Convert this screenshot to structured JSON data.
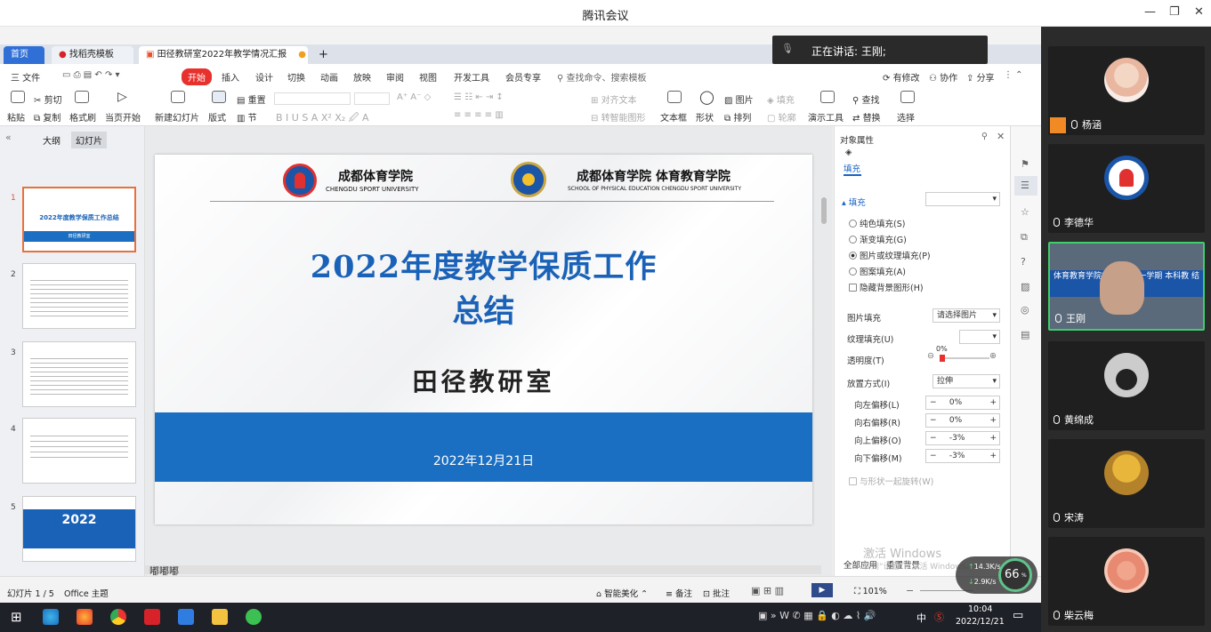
{
  "meeting": {
    "title": "腾讯会议",
    "speaking_label": "正在讲话: 王刚;"
  },
  "tabs": [
    {
      "label": "首页"
    },
    {
      "label": "找稻壳模板"
    },
    {
      "label": "田径教研室2022年教学情况汇报"
    }
  ],
  "menu": {
    "file": "三 文件",
    "start": "开始",
    "items": [
      "插入",
      "设计",
      "切换",
      "动画",
      "放映",
      "审阅",
      "视图",
      "开发工具",
      "会员专享"
    ],
    "search_placeholder": "查找命令、搜索模板",
    "right": [
      "有修改",
      "协作",
      "分享"
    ]
  },
  "ribbon": {
    "paste": "粘贴",
    "cut": "剪切",
    "copy": "复制",
    "format_painter": "格式刷",
    "from_current": "当页开始",
    "new_slide": "新建幻灯片",
    "layout": "版式",
    "section": "节",
    "reset": "重置",
    "align_text": "对齐文本",
    "convert_smartart": "转智能图形",
    "textbox": "文本框",
    "shape": "形状",
    "picture": "图片",
    "arrange": "排列",
    "fill": "填充",
    "outline": "轮廓",
    "presentation_tools": "演示工具",
    "find": "查找",
    "replace": "替换",
    "select": "选择"
  },
  "outline_tabs": {
    "outline": "大纲",
    "slides": "幻灯片"
  },
  "thumbnails": [
    {
      "num": "1",
      "title": "2022年度教学保质工作总结",
      "sub": "田径教研室"
    },
    {
      "num": "2"
    },
    {
      "num": "3"
    },
    {
      "num": "4"
    },
    {
      "num": "5",
      "big": "2022"
    }
  ],
  "slide": {
    "school_cn": "成都体育学院",
    "school_en": "CHENGDU SPORT UNIVERSITY",
    "college_cn": "成都体育学院 体育教育学院",
    "college_en": "SCHOOL OF PHYSICAL EDUCATION CHENGDU SPORT UNIVERSITY",
    "title_line1": "2022年度教学保质工作",
    "title_line2": "总结",
    "department": "田径教研室",
    "date": "2022年12月21日"
  },
  "notes": {
    "text": "嘟嘟嘟"
  },
  "props": {
    "header": "对象属性",
    "tab": "填充",
    "section": "填充",
    "options": [
      "纯色填充(S)",
      "渐变填充(G)",
      "图片或纹理填充(P)",
      "图案填充(A)"
    ],
    "hide_bg": "隐藏背景图形(H)",
    "picture_fill_label": "图片填充",
    "picture_fill_value": "请选择图片",
    "texture_fill_label": "纹理填充(U)",
    "transparency_label": "透明度(T)",
    "transparency_value": "0%",
    "placement_label": "放置方式(I)",
    "placement_value": "拉伸",
    "offsets": [
      {
        "label": "向左偏移(L)",
        "value": "0%"
      },
      {
        "label": "向右偏移(R)",
        "value": "0%"
      },
      {
        "label": "向上偏移(O)",
        "value": "-3%"
      },
      {
        "label": "向下偏移(M)",
        "value": "-3%"
      }
    ],
    "rotate_with_shape": "与形状一起旋转(W)",
    "apply_all": "全部应用",
    "reset_bg": "重置背景"
  },
  "watermark": {
    "line1": "激活 Windows",
    "line2": "转到“设置”以激活 Windows。"
  },
  "status": {
    "slide_count": "幻灯片 1 / 5",
    "theme": "Office 主题",
    "smart": "智能美化",
    "notes": "备注",
    "comments": "批注",
    "zoom": "101%"
  },
  "net": {
    "up": "14.3",
    "up_unit": "K/s",
    "down": "2.9",
    "down_unit": "K/s",
    "percent": "66",
    "percent_unit": "%"
  },
  "participants": [
    {
      "name": "杨涵"
    },
    {
      "name": "李德华"
    },
    {
      "name": "王刚",
      "banner": "体育教育学院20 学年第一学期 本科教 结会"
    },
    {
      "name": "黄绵成"
    },
    {
      "name": "宋涛"
    },
    {
      "name": "柴云梅"
    }
  ],
  "taskbar": {
    "ime": "中",
    "time": "10:04",
    "date": "2022/12/21"
  },
  "colors": {
    "accent": "#1a62c6",
    "slide_blue": "#1a6fc2",
    "title_blue": "#1a62b8",
    "start_tab": "#e8302c",
    "wps_red": "#d8222a"
  }
}
